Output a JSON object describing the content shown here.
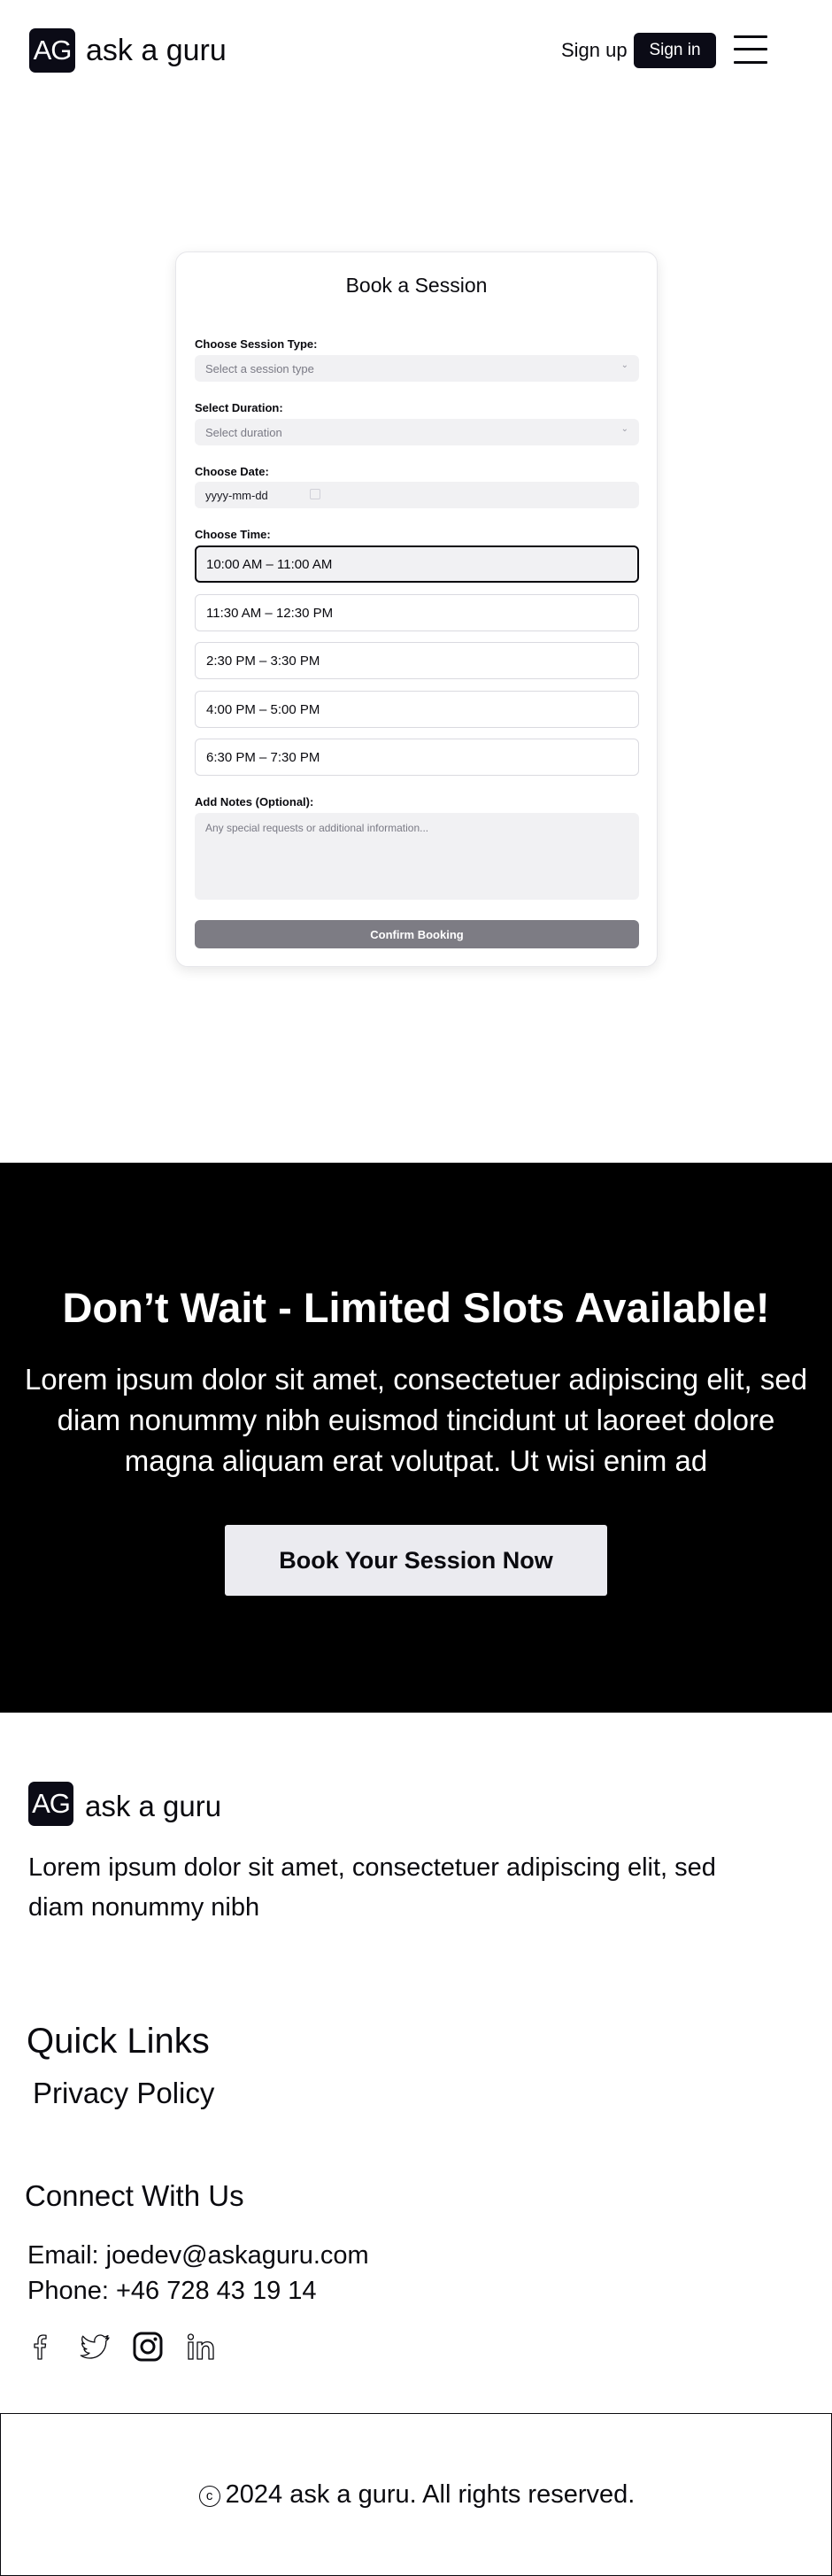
{
  "header": {
    "logo_mark": "AG",
    "brand": "ask a guru",
    "signup_label": "Sign up",
    "signin_label": "Sign in",
    "menu_icon": "hamburger-menu-icon"
  },
  "booking": {
    "title": "Book a Session",
    "session_type": {
      "label": "Choose Session Type:",
      "placeholder": "Select a session type"
    },
    "duration": {
      "label": "Select Duration:",
      "placeholder": "Select duration"
    },
    "date": {
      "label": "Choose Date:",
      "placeholder": "yyyy-mm-dd"
    },
    "time": {
      "label": "Choose Time:",
      "selected_index": 0,
      "slots": [
        "10:00 AM – 11:00 AM",
        "11:30 AM – 12:30 PM",
        "2:30 PM – 3:30 PM",
        "4:00 PM – 5:00 PM",
        "6:30 PM – 7:30 PM"
      ]
    },
    "notes": {
      "label": "Add Notes (Optional):",
      "placeholder": "Any special requests or additional information..."
    },
    "confirm_label": "Confirm Booking"
  },
  "cta": {
    "title": "Don’t Wait - Limited Slots Available!",
    "text": "Lorem ipsum dolor sit amet, consectetuer adipiscing elit, sed diam nonummy nibh euismod tincidunt ut laoreet dolore magna aliquam erat volutpat. Ut wisi enim ad",
    "button_label": "Book Your Session Now"
  },
  "footer": {
    "logo_mark": "AG",
    "brand": "ask a guru",
    "description": "Lorem ipsum dolor sit amet, consectetuer adipiscing elit, sed diam nonummy nibh",
    "quick_links_title": "Quick Links",
    "links": [
      "Privacy Policy"
    ],
    "connect_title": "Connect With Us",
    "email": "Email: joedev@askaguru.com",
    "phone": "Phone: +46 728 43 19 14",
    "social_icons": [
      "facebook-icon",
      "twitter-icon",
      "instagram-icon",
      "linkedin-icon"
    ],
    "copyright_symbol": "c",
    "copyright": "2024 ask a guru. All rights reserved."
  },
  "colors": {
    "brand_dark": "#0b0b16",
    "cta_background": "#000000",
    "confirm_button": "#7d7c84",
    "input_background": "#f1f1f3"
  }
}
